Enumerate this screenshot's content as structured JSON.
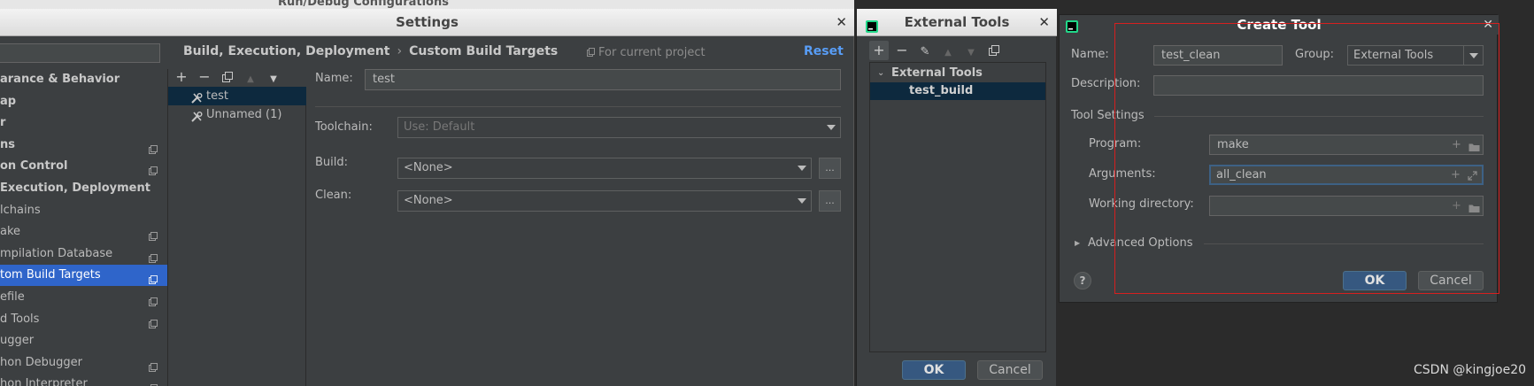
{
  "background_window": {
    "title": "Run/Debug Configurations"
  },
  "settings": {
    "title": "Settings",
    "breadcrumb": [
      "Build, Execution, Deployment",
      "Custom Build Targets"
    ],
    "for_current_project": "For current project",
    "reset": "Reset",
    "tree": [
      {
        "label": "arance & Behavior",
        "bold": true,
        "copy": false
      },
      {
        "label": "ap",
        "bold": true,
        "copy": false
      },
      {
        "label": "r",
        "bold": true,
        "copy": false
      },
      {
        "label": "ns",
        "bold": true,
        "copy": true
      },
      {
        "label": "on Control",
        "bold": true,
        "copy": true
      },
      {
        "label": "Execution, Deployment",
        "bold": true,
        "copy": false
      },
      {
        "label": "lchains",
        "bold": false,
        "copy": false
      },
      {
        "label": "ake",
        "bold": false,
        "copy": true
      },
      {
        "label": "mpilation Database",
        "bold": false,
        "copy": true
      },
      {
        "label": "tom Build Targets",
        "bold": false,
        "copy": true,
        "selected": true
      },
      {
        "label": "efile",
        "bold": false,
        "copy": true
      },
      {
        "label": "d Tools",
        "bold": false,
        "copy": true
      },
      {
        "label": "ugger",
        "bold": false,
        "copy": false
      },
      {
        "label": "hon Debugger",
        "bold": false,
        "copy": true
      },
      {
        "label": "hon Interpreter",
        "bold": false,
        "copy": true
      }
    ],
    "targets": [
      {
        "label": "test",
        "selected": true
      },
      {
        "label": "Unnamed (1)",
        "selected": false
      }
    ],
    "form": {
      "name_label": "Name:",
      "name_value": "test",
      "toolchain_label": "Toolchain:",
      "toolchain_value": "Use: Default",
      "build_label": "Build:",
      "build_value": "<None>",
      "clean_label": "Clean:",
      "clean_value": "<None>",
      "ellipsis": "..."
    }
  },
  "external_tools": {
    "title": "External Tools",
    "group": "External Tools",
    "item": "test_build",
    "ok": "OK",
    "cancel": "Cancel"
  },
  "create_tool": {
    "title": "Create Tool",
    "name_label": "Name:",
    "name_value": "test_clean",
    "group_label": "Group:",
    "group_value": "External Tools",
    "description_label": "Description:",
    "description_value": "",
    "tool_settings": "Tool Settings",
    "program_label": "Program:",
    "program_value": "make",
    "arguments_label": "Arguments:",
    "arguments_value": "all_clean",
    "working_dir_label": "Working directory:",
    "working_dir_value": "",
    "advanced_options": "Advanced Options",
    "help": "?",
    "ok": "OK",
    "cancel": "Cancel"
  },
  "watermark": "CSDN @kingjoe20",
  "colors": {
    "selection": "#2f65ca",
    "link": "#589df6",
    "annotation_box": "#d61f1f",
    "primary_button": "#365880"
  }
}
